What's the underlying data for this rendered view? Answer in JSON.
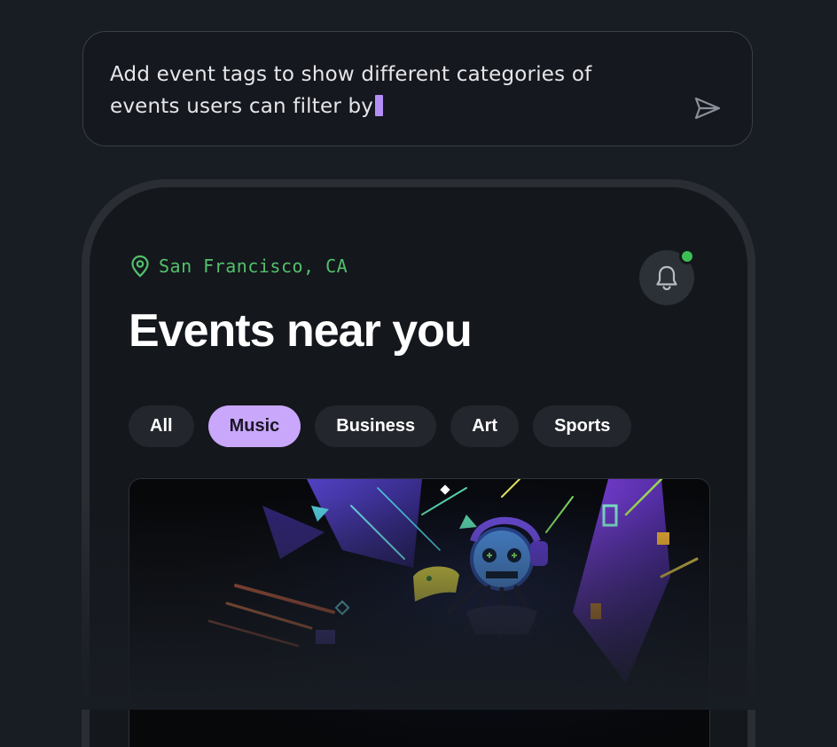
{
  "prompt": {
    "text": "Add event tags to show different categories of events users can filter by",
    "send_icon": "send-icon"
  },
  "app": {
    "location": "San Francisco, CA",
    "title": "Events near you",
    "notification_icon": "bell-icon",
    "filters": [
      {
        "label": "All",
        "active": false
      },
      {
        "label": "Music",
        "active": true
      },
      {
        "label": "Business",
        "active": false
      },
      {
        "label": "Art",
        "active": false
      },
      {
        "label": "Sports",
        "active": false
      }
    ]
  },
  "colors": {
    "accent": "#c9a7fb",
    "location_green": "#52c16b",
    "notification_dot": "#3bbf55",
    "caret": "#b38ef7"
  }
}
